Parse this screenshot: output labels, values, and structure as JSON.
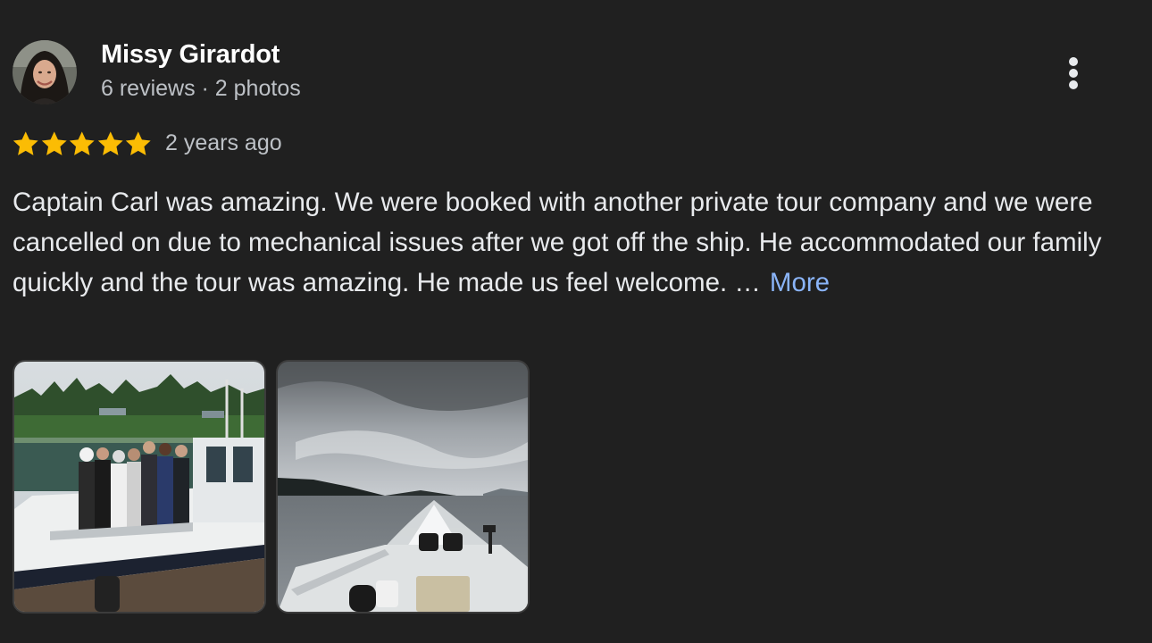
{
  "review": {
    "author_name": "Missy Girardot",
    "author_meta": "6 reviews · 2 photos",
    "rating": 5,
    "time_ago": "2 years ago",
    "text": "Captain Carl was amazing. We were booked with another private tour company and we were cancelled on due to mechanical issues after we got off the ship. He accommodated our family quickly and the tour was amazing. He made us feel welcome. …",
    "more_label": "More",
    "photos": [
      "group-on-boat-photo",
      "boat-wake-photo"
    ]
  },
  "colors": {
    "background": "#202020",
    "name": "#ffffff",
    "meta": "#bdc1c6",
    "body_text": "#e8eaed",
    "star": "#fbbc04",
    "link": "#8ab4f8"
  },
  "icons": {
    "menu": "more-vert-icon",
    "star": "star-icon"
  }
}
